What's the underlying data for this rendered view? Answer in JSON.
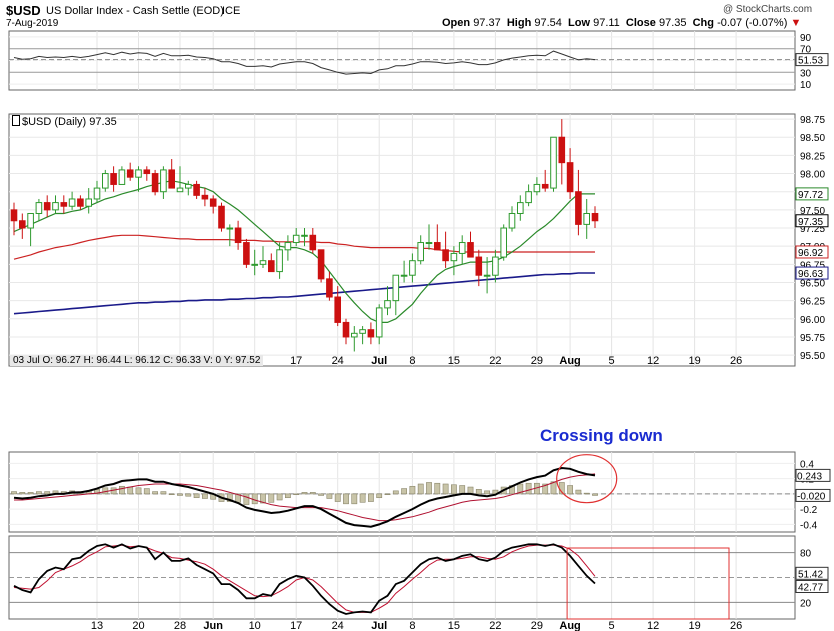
{
  "header": {
    "symbol": "$USD",
    "name": "US Dollar Index - Cash Settle (EOD)",
    "exchange": "ICE",
    "date": "7-Aug-2019",
    "watermark": "@ StockCharts.com",
    "open_label": "Open",
    "open": "97.37",
    "high_label": "High",
    "high": "97.54",
    "low_label": "Low",
    "low": "97.11",
    "close_label": "Close",
    "close": "97.35",
    "chg_label": "Chg",
    "chg": "-0.07 (-0.07%)"
  },
  "main_panel": {
    "legend": "$USD (Daily) 97.35",
    "hover_info": "03 Jul O: 96.27   H: 96.44   L: 96.12   C: 96.33   V: 0   Y: 97.52",
    "yticks": [
      "98.75",
      "98.50",
      "98.25",
      "98.00",
      "97.75",
      "97.50",
      "97.25",
      "97.00",
      "96.75",
      "96.50",
      "96.25",
      "96.00",
      "95.75",
      "95.50"
    ],
    "badges": [
      {
        "text": "97.72",
        "value": 97.72,
        "bg": "#ffffff",
        "fg": "#000000",
        "border": "#2a8a2a"
      },
      {
        "text": "97.35",
        "value": 97.35,
        "bg": "#ffffff",
        "fg": "#000000",
        "border": "#000000"
      },
      {
        "text": "96.92",
        "value": 96.92,
        "bg": "#ffffff",
        "fg": "#000000",
        "border": "#cc2222"
      },
      {
        "text": "96.63",
        "value": 96.63,
        "bg": "#ffffff",
        "fg": "#000000",
        "border": "#1a1a8a"
      }
    ]
  },
  "x_labels": [
    "13",
    "20",
    "28",
    "Jun",
    "10",
    "17",
    "24",
    "Jul",
    "8",
    "15",
    "22",
    "29",
    "Aug",
    "5",
    "12",
    "19",
    "26"
  ],
  "rsi_panel": {
    "yticks": [
      "90",
      "70",
      "50",
      "30",
      "10"
    ],
    "badge": "51.53"
  },
  "macd_panel": {
    "annotation": "Crossing down",
    "yticks": [
      "0.4",
      "0.2",
      "0.0",
      "-0.2",
      "-0.4"
    ],
    "badges": [
      "0.243",
      "-0.020"
    ]
  },
  "stoch_panel": {
    "yticks": [
      "80",
      "20"
    ],
    "badges": [
      "51.42",
      "42.77"
    ]
  },
  "colors": {
    "up": "#2e9a2e",
    "down": "#cc1010",
    "sma_short": "#2a8a2a",
    "sma_mid": "#cc2222",
    "sma_long": "#1a1a8a",
    "annot": "#1a2bd0",
    "circle": "#e03030"
  },
  "chart_data": {
    "type": "candlestick",
    "title": "$USD US Dollar Index - Cash Settle (EOD) ICE",
    "ylim": [
      95.35,
      98.82
    ],
    "days": [
      "Apr 29",
      "Apr 30",
      "May 1",
      "May 2",
      "May 3",
      "May 6",
      "May 7",
      "May 8",
      "May 9",
      "May 10",
      "May 13",
      "May 14",
      "May 15",
      "May 16",
      "May 17",
      "May 20",
      "May 21",
      "May 22",
      "May 23",
      "May 24",
      "May 28",
      "May 29",
      "May 30",
      "May 31",
      "Jun 3",
      "Jun 4",
      "Jun 5",
      "Jun 6",
      "Jun 7",
      "Jun 10",
      "Jun 11",
      "Jun 12",
      "Jun 13",
      "Jun 14",
      "Jun 17",
      "Jun 18",
      "Jun 19",
      "Jun 20",
      "Jun 21",
      "Jun 24",
      "Jun 25",
      "Jun 26",
      "Jun 27",
      "Jun 28",
      "Jul 1",
      "Jul 2",
      "Jul 3",
      "Jul 5",
      "Jul 8",
      "Jul 9",
      "Jul 10",
      "Jul 11",
      "Jul 12",
      "Jul 15",
      "Jul 16",
      "Jul 17",
      "Jul 18",
      "Jul 19",
      "Jul 22",
      "Jul 23",
      "Jul 24",
      "Jul 25",
      "Jul 26",
      "Jul 29",
      "Jul 30",
      "Jul 31",
      "Aug 1",
      "Aug 2",
      "Aug 5",
      "Aug 6",
      "Aug 7"
    ],
    "open": [
      97.5,
      97.35,
      97.25,
      97.45,
      97.6,
      97.5,
      97.6,
      97.55,
      97.65,
      97.55,
      97.65,
      97.8,
      98.0,
      97.85,
      98.05,
      97.95,
      98.05,
      98.0,
      97.75,
      98.05,
      97.75,
      97.8,
      97.85,
      97.7,
      97.65,
      97.55,
      97.25,
      97.25,
      97.05,
      96.75,
      96.75,
      96.8,
      96.65,
      96.95,
      97.05,
      97.15,
      97.15,
      96.95,
      96.55,
      96.3,
      95.95,
      95.75,
      95.8,
      95.85,
      95.75,
      96.15,
      96.25,
      96.6,
      96.6,
      96.8,
      97.05,
      97.05,
      96.95,
      96.8,
      96.9,
      97.05,
      96.85,
      96.6,
      96.6,
      96.85,
      97.25,
      97.45,
      97.6,
      97.75,
      97.85,
      97.8,
      98.5,
      98.15,
      97.75,
      97.3,
      97.45
    ],
    "high": [
      97.6,
      97.45,
      97.45,
      97.65,
      97.7,
      97.7,
      97.7,
      97.75,
      97.7,
      97.8,
      97.9,
      98.05,
      98.1,
      98.1,
      98.15,
      98.1,
      98.1,
      98.05,
      98.1,
      98.2,
      98.1,
      97.9,
      97.9,
      97.8,
      97.7,
      97.6,
      97.3,
      97.35,
      97.1,
      96.95,
      97.0,
      96.9,
      97.05,
      97.15,
      97.25,
      97.25,
      97.25,
      96.95,
      96.65,
      96.45,
      96.0,
      95.9,
      95.9,
      95.95,
      96.2,
      96.45,
      96.5,
      96.8,
      96.9,
      97.15,
      97.3,
      97.3,
      97.2,
      97.0,
      97.15,
      97.2,
      96.95,
      96.85,
      96.95,
      97.3,
      97.55,
      97.7,
      97.85,
      97.95,
      98.05,
      98.4,
      98.75,
      98.35,
      98.05,
      97.65,
      97.55
    ],
    "low": [
      97.15,
      97.1,
      97.0,
      97.35,
      97.4,
      97.45,
      97.45,
      97.5,
      97.5,
      97.45,
      97.6,
      97.75,
      97.75,
      97.85,
      97.9,
      97.75,
      97.9,
      97.7,
      97.65,
      97.95,
      97.75,
      97.7,
      97.65,
      97.55,
      97.45,
      97.2,
      97.0,
      96.95,
      96.7,
      96.6,
      96.7,
      96.65,
      96.55,
      96.8,
      97.0,
      97.0,
      96.9,
      96.5,
      96.25,
      95.9,
      95.65,
      95.55,
      95.65,
      95.65,
      95.65,
      96.05,
      96.05,
      96.5,
      96.5,
      96.75,
      96.95,
      96.95,
      96.7,
      96.6,
      96.75,
      96.85,
      96.45,
      96.35,
      96.5,
      96.8,
      97.2,
      97.35,
      97.55,
      97.7,
      97.75,
      97.75,
      97.85,
      97.65,
      97.15,
      97.1,
      97.25
    ],
    "close": [
      97.35,
      97.25,
      97.45,
      97.6,
      97.5,
      97.6,
      97.55,
      97.65,
      97.55,
      97.65,
      97.8,
      98.0,
      97.85,
      98.05,
      97.95,
      98.05,
      98.0,
      97.75,
      98.05,
      97.8,
      97.8,
      97.85,
      97.7,
      97.65,
      97.55,
      97.25,
      97.25,
      97.05,
      96.75,
      96.75,
      96.8,
      96.65,
      96.95,
      97.05,
      97.15,
      97.15,
      96.95,
      96.55,
      96.3,
      95.95,
      95.75,
      95.8,
      95.85,
      95.75,
      96.15,
      96.25,
      96.6,
      96.6,
      96.8,
      97.05,
      97.05,
      96.95,
      96.8,
      96.9,
      97.05,
      96.85,
      96.6,
      96.6,
      96.85,
      97.25,
      97.45,
      97.6,
      97.75,
      97.85,
      97.8,
      98.5,
      98.15,
      97.75,
      97.3,
      97.45,
      97.35
    ],
    "sma_short": [
      97.2,
      97.25,
      97.3,
      97.35,
      97.4,
      97.45,
      97.45,
      97.48,
      97.5,
      97.55,
      97.6,
      97.65,
      97.68,
      97.72,
      97.75,
      97.78,
      97.82,
      97.85,
      97.88,
      97.9,
      97.88,
      97.85,
      97.82,
      97.8,
      97.75,
      97.65,
      97.58,
      97.5,
      97.4,
      97.3,
      97.2,
      97.1,
      97.0,
      96.98,
      96.98,
      96.95,
      96.9,
      96.8,
      96.65,
      96.5,
      96.35,
      96.22,
      96.1,
      96.0,
      95.95,
      95.95,
      96.0,
      96.1,
      96.2,
      96.35,
      96.48,
      96.6,
      96.68,
      96.72,
      96.75,
      96.78,
      96.78,
      96.78,
      96.8,
      96.85,
      96.92,
      97.0,
      97.1,
      97.2,
      97.28,
      97.38,
      97.5,
      97.62,
      97.72,
      97.72,
      97.72
    ],
    "sma_mid": [
      96.82,
      96.85,
      96.88,
      96.92,
      96.95,
      96.98,
      97.0,
      97.02,
      97.05,
      97.08,
      97.1,
      97.12,
      97.14,
      97.15,
      97.15,
      97.15,
      97.14,
      97.13,
      97.12,
      97.11,
      97.1,
      97.1,
      97.09,
      97.09,
      97.09,
      97.09,
      97.09,
      97.08,
      97.08,
      97.08,
      97.07,
      97.07,
      97.06,
      97.06,
      97.06,
      97.06,
      97.06,
      97.05,
      97.05,
      97.03,
      97.02,
      97.0,
      96.99,
      96.98,
      96.98,
      96.98,
      96.98,
      96.98,
      96.98,
      96.97,
      96.97,
      96.95,
      96.94,
      96.93,
      96.92,
      96.92,
      96.92,
      96.92,
      96.92,
      96.92,
      96.92,
      96.92,
      96.92,
      96.92,
      96.92,
      96.92,
      96.92,
      96.92,
      96.92,
      96.92,
      96.92
    ],
    "sma_long": [
      96.07,
      96.08,
      96.09,
      96.1,
      96.11,
      96.12,
      96.13,
      96.14,
      96.15,
      96.16,
      96.17,
      96.18,
      96.19,
      96.2,
      96.21,
      96.22,
      96.22,
      96.23,
      96.23,
      96.24,
      96.24,
      96.25,
      96.25,
      96.26,
      96.26,
      96.26,
      96.27,
      96.27,
      96.28,
      96.28,
      96.29,
      96.29,
      96.3,
      96.3,
      96.31,
      96.32,
      96.33,
      96.34,
      96.35,
      96.36,
      96.37,
      96.38,
      96.39,
      96.4,
      96.41,
      96.42,
      96.43,
      96.44,
      96.45,
      96.46,
      96.47,
      96.48,
      96.49,
      96.5,
      96.51,
      96.52,
      96.53,
      96.54,
      96.55,
      96.56,
      96.57,
      96.58,
      96.59,
      96.6,
      96.61,
      96.61,
      96.62,
      96.62,
      96.63,
      96.63,
      96.63
    ],
    "rsi": [
      55,
      52,
      53,
      57,
      55,
      56,
      55,
      57,
      55,
      57,
      60,
      63,
      60,
      64,
      61,
      63,
      62,
      57,
      62,
      58,
      58,
      59,
      56,
      55,
      53,
      48,
      48,
      45,
      40,
      40,
      41,
      39,
      44,
      46,
      48,
      48,
      45,
      38,
      34,
      30,
      27,
      28,
      29,
      28,
      34,
      36,
      41,
      41,
      44,
      48,
      48,
      47,
      45,
      46,
      48,
      46,
      43,
      43,
      46,
      51,
      54,
      56,
      58,
      59,
      58,
      66,
      61,
      56,
      51,
      53,
      51.53
    ],
    "macd": [
      -0.05,
      -0.06,
      -0.05,
      -0.03,
      -0.02,
      0.0,
      0.0,
      0.02,
      0.02,
      0.04,
      0.07,
      0.11,
      0.13,
      0.17,
      0.18,
      0.19,
      0.19,
      0.16,
      0.16,
      0.13,
      0.11,
      0.09,
      0.06,
      0.03,
      0.0,
      -0.05,
      -0.08,
      -0.12,
      -0.18,
      -0.21,
      -0.23,
      -0.25,
      -0.24,
      -0.22,
      -0.19,
      -0.16,
      -0.16,
      -0.2,
      -0.26,
      -0.32,
      -0.38,
      -0.41,
      -0.42,
      -0.43,
      -0.4,
      -0.36,
      -0.3,
      -0.25,
      -0.2,
      -0.14,
      -0.09,
      -0.06,
      -0.04,
      -0.02,
      0.0,
      0.0,
      -0.02,
      -0.03,
      -0.01,
      0.05,
      0.1,
      0.15,
      0.19,
      0.22,
      0.24,
      0.31,
      0.34,
      0.33,
      0.29,
      0.26,
      0.243
    ],
    "macd_signal": [
      -0.08,
      -0.08,
      -0.07,
      -0.06,
      -0.05,
      -0.04,
      -0.03,
      -0.02,
      -0.01,
      0.0,
      0.01,
      0.03,
      0.05,
      0.07,
      0.09,
      0.11,
      0.12,
      0.13,
      0.13,
      0.13,
      0.13,
      0.12,
      0.11,
      0.09,
      0.07,
      0.05,
      0.02,
      -0.01,
      -0.04,
      -0.08,
      -0.11,
      -0.14,
      -0.16,
      -0.17,
      -0.18,
      -0.18,
      -0.18,
      -0.18,
      -0.2,
      -0.22,
      -0.25,
      -0.28,
      -0.31,
      -0.33,
      -0.35,
      -0.35,
      -0.34,
      -0.32,
      -0.3,
      -0.27,
      -0.24,
      -0.2,
      -0.17,
      -0.14,
      -0.11,
      -0.09,
      -0.08,
      -0.07,
      -0.06,
      -0.04,
      -0.01,
      0.02,
      0.05,
      0.08,
      0.11,
      0.15,
      0.19,
      0.22,
      0.24,
      0.25,
      0.263
    ],
    "stoch_k": [
      40,
      35,
      32,
      48,
      58,
      62,
      60,
      72,
      74,
      82,
      88,
      90,
      86,
      90,
      85,
      88,
      86,
      72,
      80,
      70,
      70,
      73,
      65,
      60,
      55,
      42,
      42,
      35,
      25,
      25,
      30,
      28,
      42,
      48,
      52,
      50,
      40,
      28,
      18,
      10,
      6,
      8,
      9,
      8,
      22,
      28,
      42,
      46,
      56,
      66,
      72,
      74,
      70,
      72,
      76,
      78,
      72,
      70,
      74,
      82,
      86,
      88,
      90,
      90,
      88,
      90,
      86,
      76,
      64,
      52,
      42.77
    ],
    "stoch_d": [
      38,
      37,
      36,
      38,
      46,
      56,
      60,
      64,
      69,
      76,
      81,
      87,
      88,
      89,
      87,
      88,
      86,
      82,
      79,
      74,
      73,
      71,
      69,
      66,
      60,
      52,
      46,
      40,
      34,
      28,
      27,
      28,
      33,
      39,
      47,
      50,
      47,
      39,
      29,
      19,
      11,
      8,
      8,
      8,
      13,
      19,
      31,
      39,
      48,
      56,
      65,
      71,
      72,
      72,
      73,
      75,
      75,
      73,
      72,
      75,
      81,
      85,
      88,
      89,
      89,
      89,
      88,
      84,
      76,
      64,
      51.42
    ],
    "annotation_text": "Crossing down"
  }
}
